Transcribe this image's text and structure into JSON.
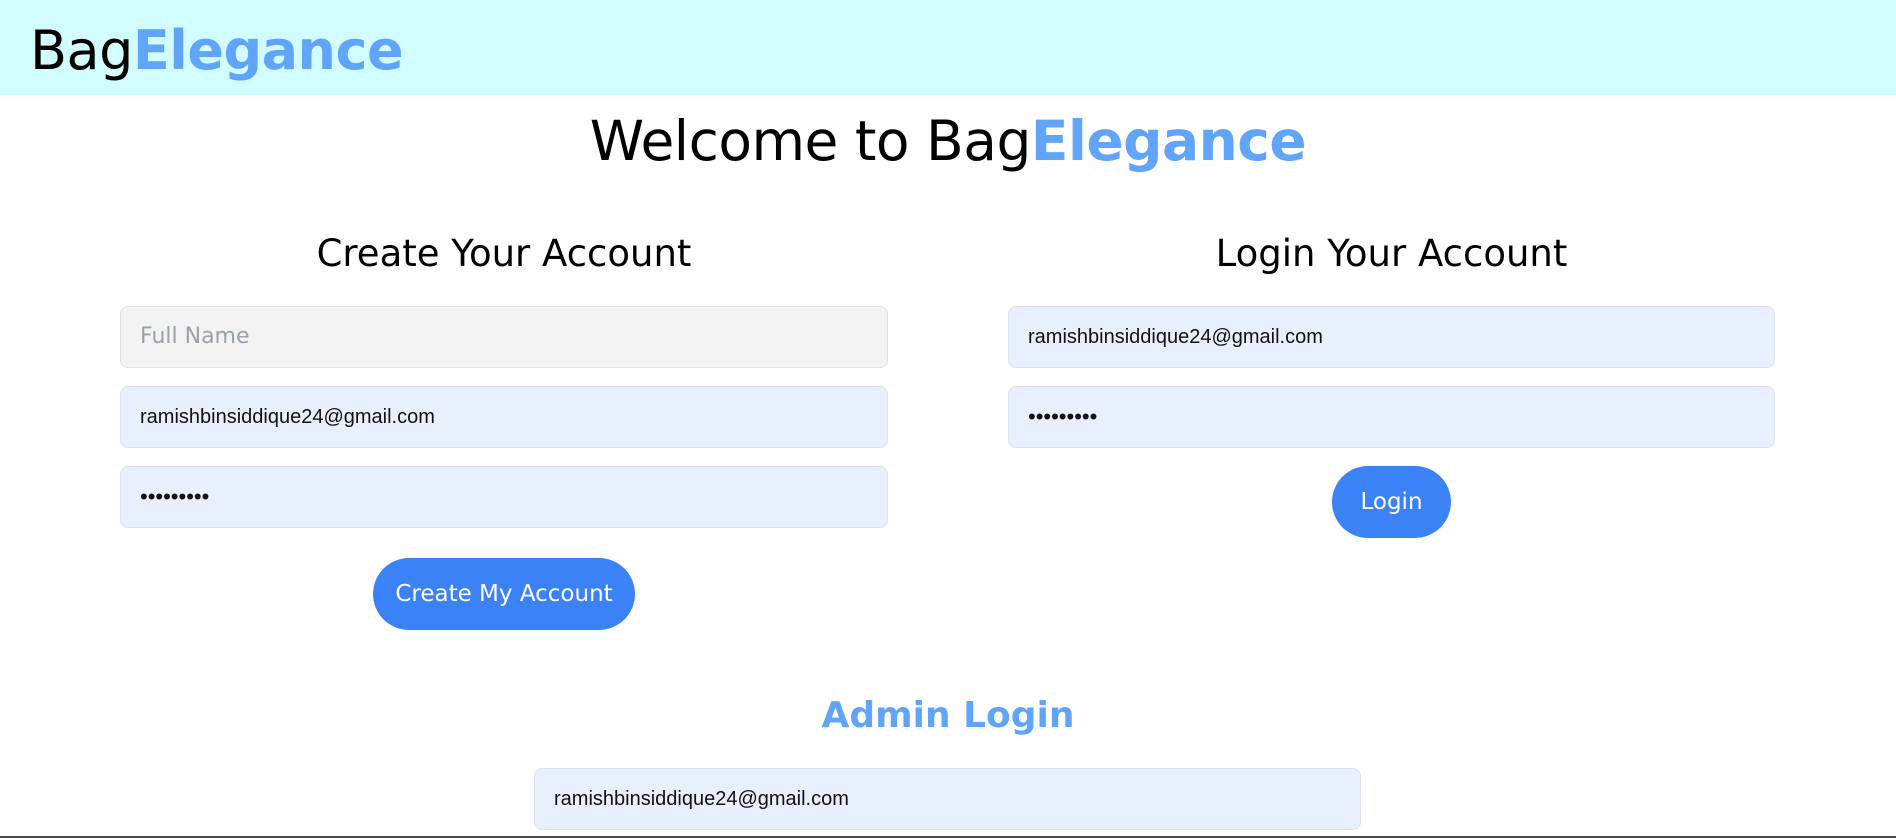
{
  "brand": {
    "prefix": "Bag",
    "accent": "Elegance"
  },
  "welcome": {
    "prefix": "Welcome to Bag",
    "accent": "Elegance"
  },
  "register": {
    "title": "Create Your Account",
    "fullname_placeholder": "Full Name",
    "fullname_value": "",
    "email_value": "ramishbinsiddique24@gmail.com",
    "password_display": "•••••••••",
    "button_label": "Create My Account"
  },
  "login": {
    "title": "Login Your Account",
    "email_value": "ramishbinsiddique24@gmail.com",
    "password_display": "•••••••••",
    "button_label": "Login"
  },
  "admin": {
    "title": "Admin Login",
    "email_value": "ramishbinsiddique24@gmail.com"
  },
  "colors": {
    "header_bg": "#d2fdff",
    "accent": "#60a5fa",
    "button": "#3b82f6",
    "autofill_bg": "#e8f0fe"
  }
}
